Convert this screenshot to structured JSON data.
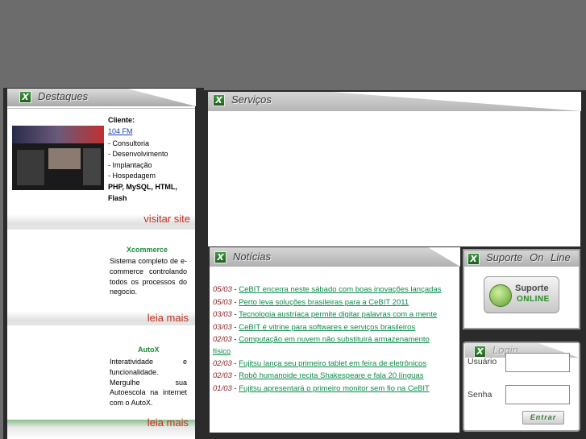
{
  "destaques": {
    "title": "Destaques",
    "client_label": "Cliente:",
    "client_link": "104 FM",
    "services": [
      "- Consultoria",
      "- Desenvolvimento",
      "- Implantação",
      "- Hospedagem"
    ],
    "tech": "PHP, MySQL, HTML,",
    "tech2": "Flash",
    "visit": "visitar site",
    "promo1": {
      "title": "Xcommerce",
      "text": "Sistema completo de e-commerce controlando todos os processos do negocio.",
      "more": "leia mais"
    },
    "promo2": {
      "title": "AutoX",
      "text": "Interatividade e funcionalidade. Mergulhe sua Autoescola na internet com o AutoX.",
      "more": "leia mais"
    }
  },
  "servicos": {
    "title": "Serviços"
  },
  "noticias": {
    "title": "Notícias",
    "items": [
      {
        "date": "05/03",
        "text": "CeBIT encerra neste sábado com boas inovações lançadas"
      },
      {
        "date": "05/03",
        "text": "Perto leva soluções brasileiras para a CeBIT 2011"
      },
      {
        "date": "03/03",
        "text": "Tecnologia austríaca permite digitar palavras com a mente"
      },
      {
        "date": "03/03",
        "text": "CeBIT é vitrine para softwares e serviços brasileiros"
      },
      {
        "date": "02/03",
        "text": "Computação em nuvem não substituirá armazenamento"
      },
      {
        "date": "",
        "text": "físico"
      },
      {
        "date": "02/03",
        "text": "Fujitsu lança seu primeiro tablet em feira de eletrônicos"
      },
      {
        "date": "02/03",
        "text": "Robô humanoide recita Shakespeare e fala 20 línguas"
      },
      {
        "date": "01/03",
        "text": "Fujitsu apresentará o primeiro monitor sem fio na CeBIT"
      }
    ]
  },
  "suporte": {
    "title": "Suporte On Line",
    "badge_line1": "Suporte",
    "badge_line2": "ONLINE"
  },
  "login": {
    "title": "Login",
    "user_label": "Usuário",
    "pass_label": "Senha",
    "submit": "Entrar"
  },
  "icon_letter": "X"
}
